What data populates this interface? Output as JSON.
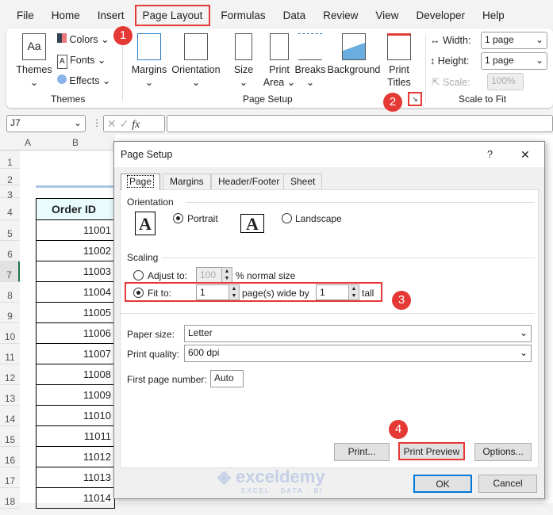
{
  "menu": {
    "items": [
      "File",
      "Home",
      "Insert",
      "Page Layout",
      "Formulas",
      "Data",
      "Review",
      "View",
      "Developer",
      "Help"
    ]
  },
  "ribbon": {
    "themes": {
      "themes_label": "Themes",
      "colors": "Colors",
      "fonts": "Fonts",
      "effects": "Effects",
      "group": "Themes"
    },
    "page_setup": {
      "margins": "Margins",
      "orientation": "Orientation",
      "size": "Size",
      "print_area": "Print Area",
      "breaks": "Breaks",
      "background": "Background",
      "print_titles": "Print Titles",
      "group": "Page Setup"
    },
    "scale": {
      "width_label": "Width:",
      "width_value": "1 page",
      "height_label": "Height:",
      "height_value": "1 page",
      "scale_label": "Scale:",
      "scale_value": "100%",
      "group": "Scale to Fit"
    }
  },
  "formula_bar": {
    "name_box": "J7",
    "fx": "fx",
    "value": ""
  },
  "sheet": {
    "columns": [
      "A",
      "B"
    ],
    "rows": [
      "1",
      "2",
      "3",
      "4",
      "5",
      "6",
      "7",
      "8",
      "9",
      "10",
      "11",
      "12",
      "13",
      "14",
      "15",
      "16",
      "17",
      "18"
    ],
    "header": "Order ID",
    "values": [
      "11001",
      "11002",
      "11003",
      "11004",
      "11005",
      "11006",
      "11007",
      "11008",
      "11009",
      "11010",
      "11011",
      "11012",
      "11013",
      "11014"
    ]
  },
  "dialog": {
    "title": "Page Setup",
    "help": "?",
    "close": "✕",
    "tabs": [
      "Page",
      "Margins",
      "Header/Footer",
      "Sheet"
    ],
    "orientation_label": "Orientation",
    "portrait": "Portrait",
    "landscape": "Landscape",
    "orientation_icon_letter": "A",
    "scaling_label": "Scaling",
    "adjust_to": "Adjust to:",
    "adjust_value": "100",
    "normal_size": "% normal size",
    "fit_to": "Fit to:",
    "fit_wide": "1",
    "pages_wide_by": "page(s) wide by",
    "fit_tall": "1",
    "tall": "tall",
    "paper_size_label": "Paper size:",
    "paper_size": "Letter",
    "print_quality_label": "Print quality:",
    "print_quality": "600 dpi",
    "first_page_label": "First page number:",
    "first_page": "Auto",
    "print": "Print...",
    "print_preview": "Print Preview",
    "options": "Options...",
    "ok": "OK",
    "cancel": "Cancel"
  },
  "badges": [
    "1",
    "2",
    "3",
    "4"
  ],
  "watermark": {
    "name": "exceldemy",
    "tagline": "EXCEL · DATA · BI"
  },
  "colors": {
    "accent": "#e53935",
    "header_fill": "#e8fbfd",
    "ok_border": "#0078d7"
  }
}
